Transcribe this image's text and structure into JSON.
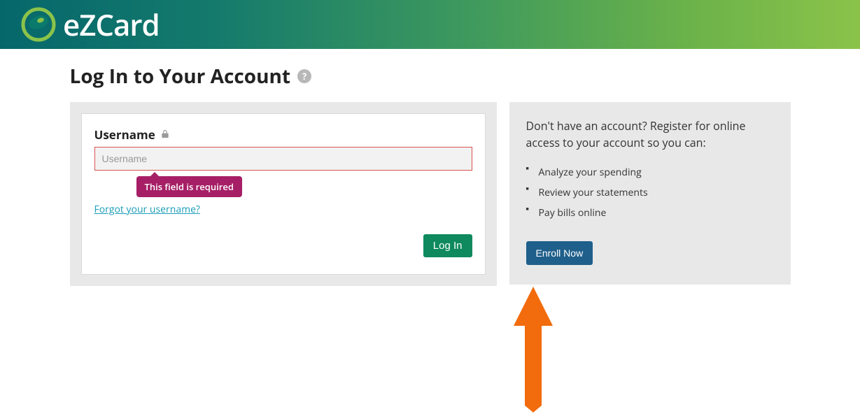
{
  "brand": {
    "name": "eZCard"
  },
  "page": {
    "title": "Log In to Your Account"
  },
  "login": {
    "username_label": "Username",
    "username_placeholder": "Username",
    "error_tooltip": "This field is required",
    "forgot_link": "Forgot your username?",
    "submit_label": "Log In"
  },
  "promo": {
    "lead": "Don't have an account? Register for online access to your account so you can:",
    "bullets": [
      "Analyze your spending",
      "Review your statements",
      "Pay bills online"
    ],
    "enroll_label": "Enroll Now"
  }
}
